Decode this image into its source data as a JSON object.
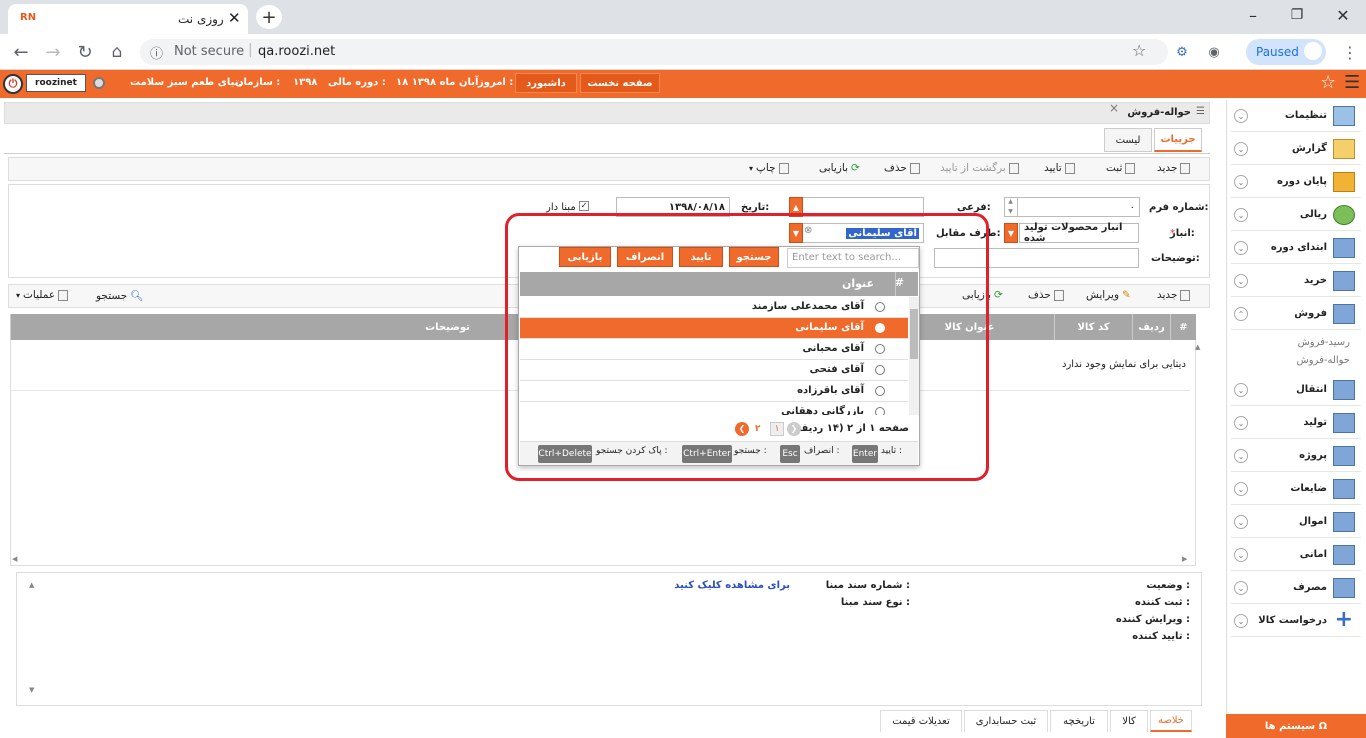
{
  "browser": {
    "tab_title": "روزی نت",
    "favicon_text": "RN",
    "not_secure": "Not secure",
    "url": "qa.roozi.net",
    "profile_status": "Paused"
  },
  "topbar": {
    "username": "roozinet",
    "home_label": "صفحه نخست",
    "dashboard_label": "داشبورد",
    "today_label": "امروز :",
    "today_value": "۱۸ آبان ماه ۱۳۹۸",
    "fiscal_label": "دوره مالی :",
    "fiscal_value": "۱۳۹۸",
    "org_label": "سازمان :",
    "org_value": "دنیای طعم سبز سلامت"
  },
  "page": {
    "title": "حواله-فروش",
    "tabs": [
      "جزییات",
      "لیست"
    ]
  },
  "toolbar": {
    "new": "جدید",
    "save": "ثبت",
    "approve": "تایید",
    "unapprove": "برگشت از تایید",
    "delete": "حذف",
    "reload": "بازیابی",
    "print": "چاپ"
  },
  "form": {
    "form_no_label": "شماره فرم:",
    "form_no_value": "۰",
    "sub_label": "فرعی:",
    "date_label": "تاریخ:",
    "date_value": "۱۳۹۸/۰۸/۱۸",
    "base_label": "مبنا دار",
    "warehouse_label": "انبار:",
    "warehouse_value": "انبار محصولات تولید شده",
    "party_label": "طرف مقابل:",
    "party_value": "آقای سلیمانی",
    "desc_label": "توضیحات:"
  },
  "items_toolbar": {
    "new": "جدید",
    "edit": "ویرایش",
    "delete": "حذف",
    "reload": "بازیابی",
    "search": "جستجو",
    "operations": "عملیات"
  },
  "grid": {
    "headers": [
      "#",
      "ردیف",
      "کد کالا",
      "عنوان کالا",
      "توضیحات"
    ],
    "empty": "دیتایی برای نمایش وجود ندارد"
  },
  "popup": {
    "search_placeholder": "Enter text to search...",
    "buttons": [
      "جستجو",
      "تایید",
      "انصراف",
      "بازیابی"
    ],
    "col_hash": "#",
    "col_title": "عنوان",
    "rows": [
      "آقای محمدعلی سازمند",
      "آقای سلیمانی",
      "آقای محبانی",
      "آقای فتحی",
      "آقای باقرزاده",
      "بازرگانی دهقانی"
    ],
    "selected_index": 1,
    "pager": "صفحه ۱ از ۲ (۱۴ ردیف)",
    "page_1": "۱",
    "page_2": "۲",
    "keys": {
      "confirm_label": "تایید :",
      "confirm_key": "Enter",
      "cancel_label": "انصراف :",
      "cancel_key": "Esc",
      "search_label": "جستجو :",
      "search_key": "Ctrl+Enter",
      "clear_label": "پاک کردن جستجو :",
      "clear_key": "Ctrl+Delete"
    }
  },
  "footer": {
    "status_label": "وضعیت :",
    "creator_label": "ثبت کننده :",
    "editor_label": "ویرایش کننده :",
    "approver_label": "تایید کننده :",
    "base_no_label": "شماره سند مبنا :",
    "base_type_label": "نوع سند مبنا :",
    "view_link": "برای مشاهده کلیک کنید"
  },
  "bottom_tabs": [
    "خلاصه",
    "کالا",
    "تاریخچه",
    "ثبت حسابداری",
    "تعدیلات قیمت"
  ],
  "sidebar": {
    "items": [
      "تنظیمات",
      "گزارش",
      "پایان دوره",
      "ریالی",
      "ابتدای دوره",
      "خرید",
      "فروش",
      "انتقال",
      "تولید",
      "پروژه",
      "ضایعات",
      "اموال",
      "امانی",
      "مصرف",
      "درخواست کالا"
    ],
    "sub_items": [
      "رسید-فروش",
      "حواله-فروش"
    ],
    "system_button": "سیستم ها"
  }
}
